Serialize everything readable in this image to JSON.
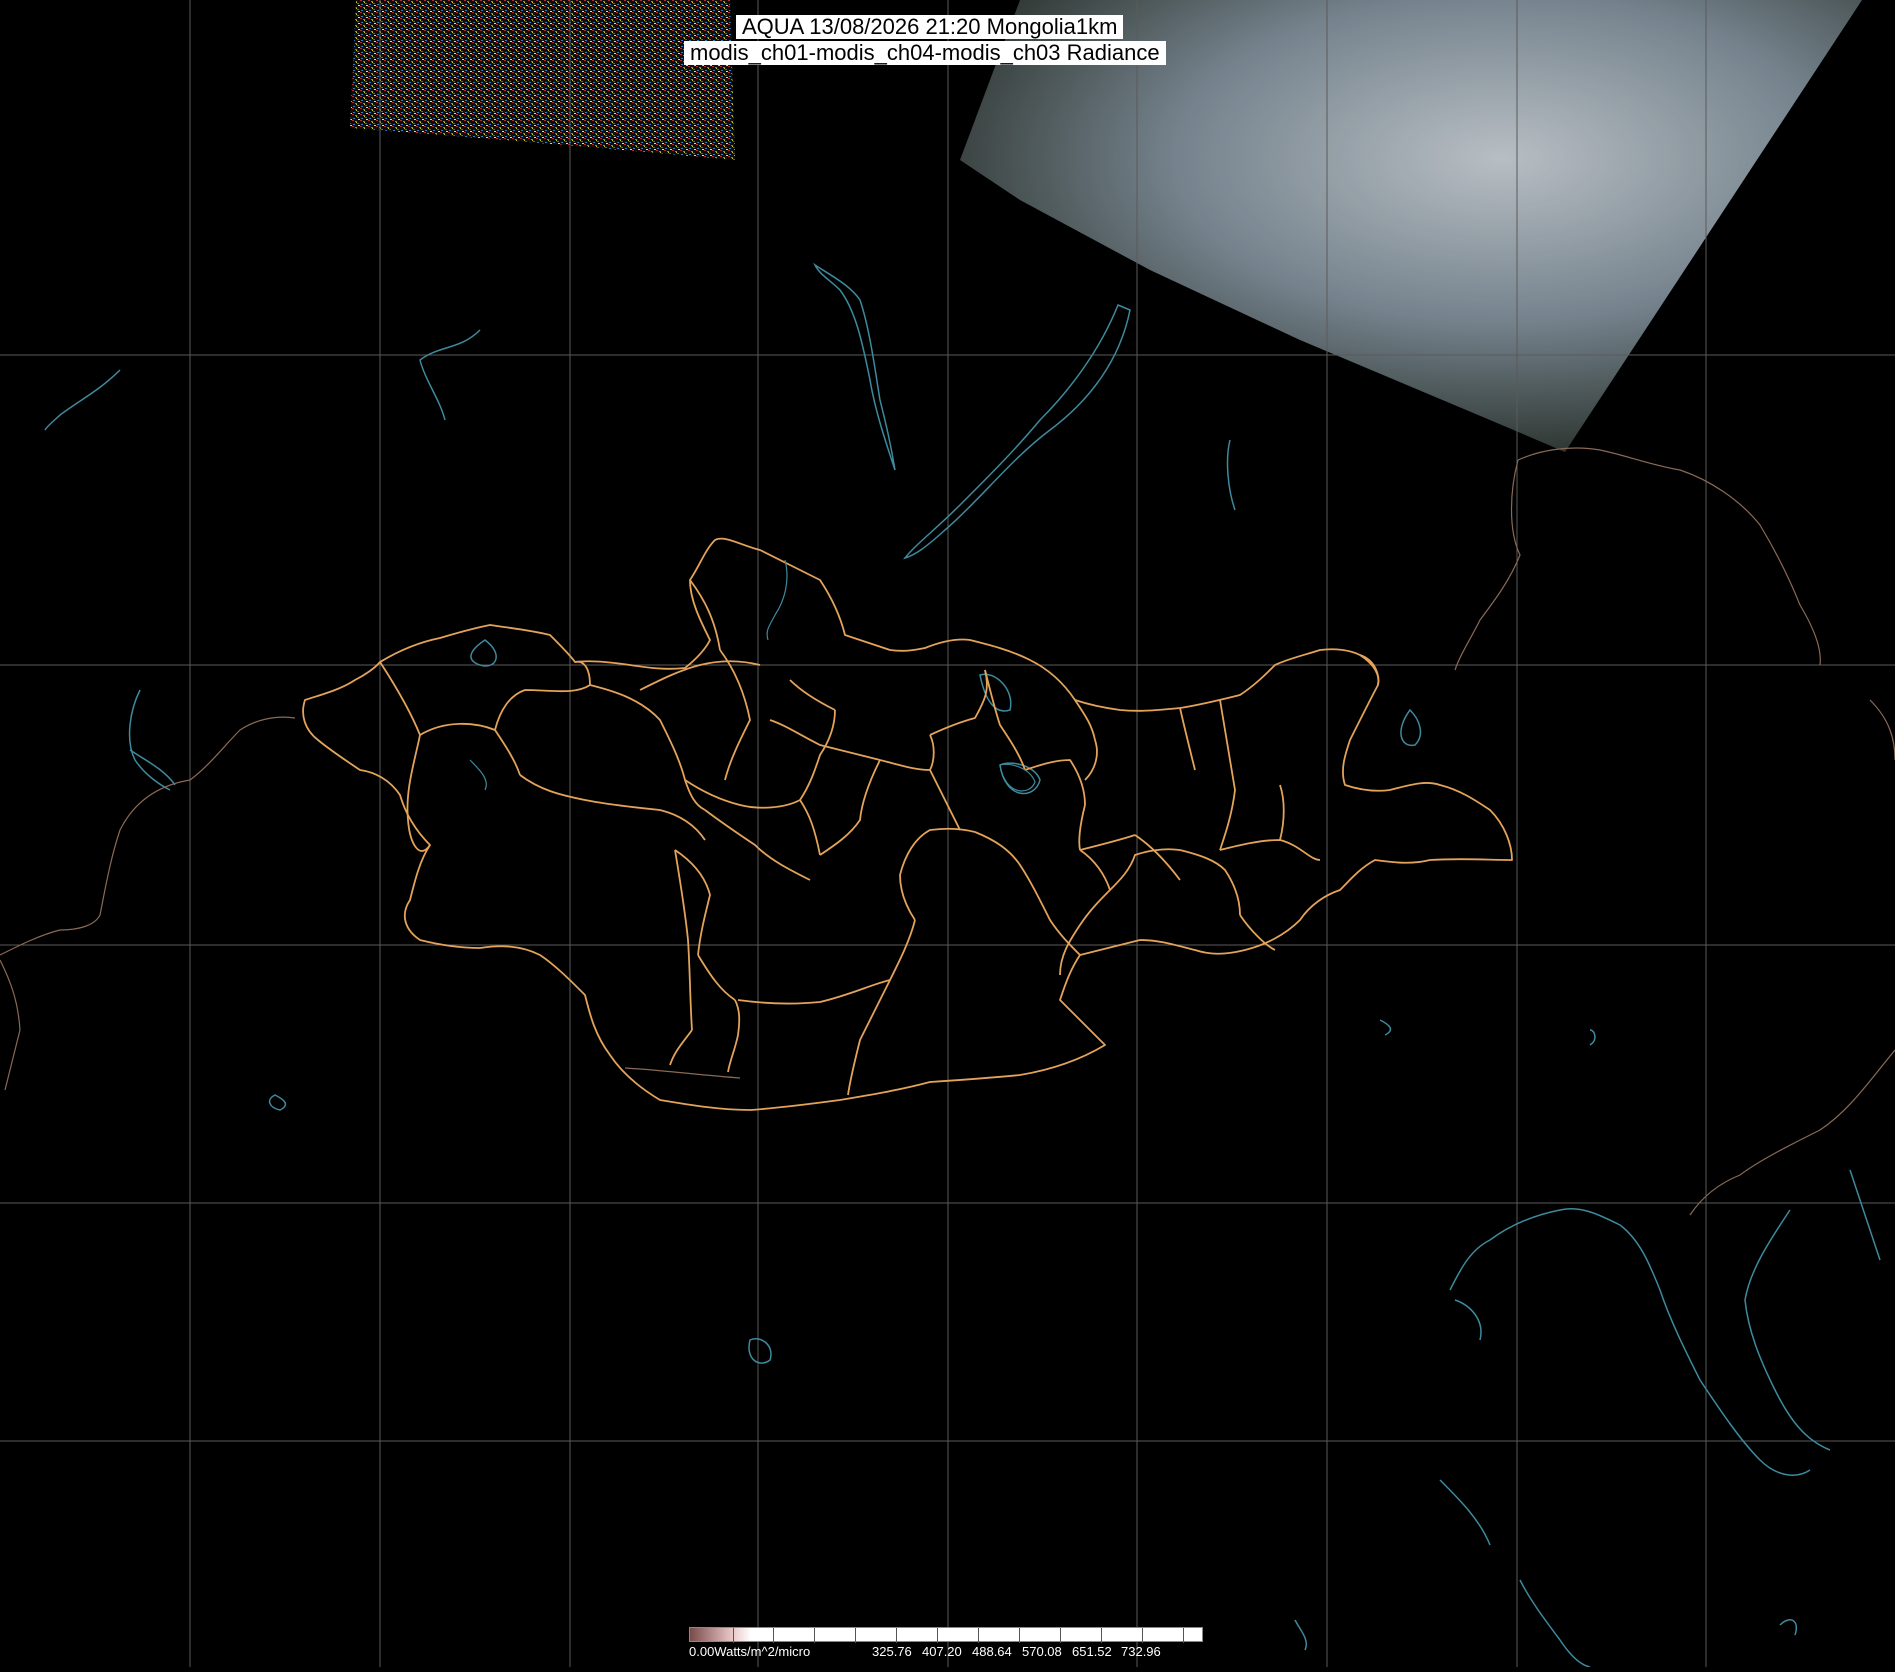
{
  "title": {
    "line1": "AQUA 13/08/2026 21:20 Mongolia1km",
    "line2": "modis_ch01-modis_ch04-modis_ch03 Radiance"
  },
  "legend": {
    "labels": [
      "0.00Watts/m^2/micro",
      "325.76",
      "407.20",
      "488.64",
      "570.08",
      "651.52",
      "732.96"
    ]
  },
  "colors": {
    "background": "#000000",
    "graticule": "#5a5a5a",
    "province_border": "#e3a35a",
    "coastline": "#3e8a9e",
    "cloud": "#cdd6dd",
    "land": "#4b5a50"
  }
}
